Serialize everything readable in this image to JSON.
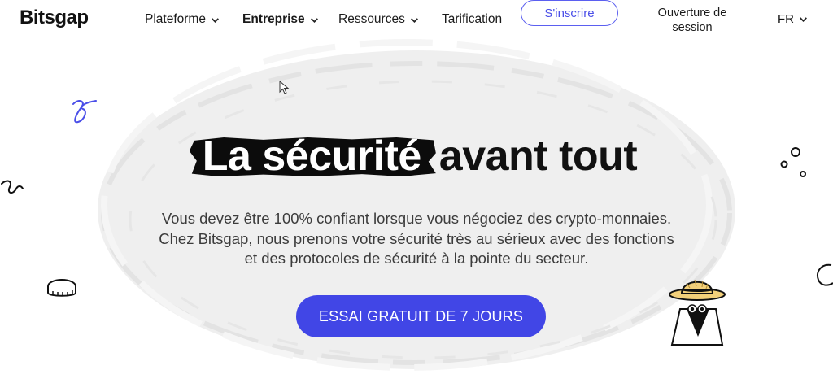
{
  "header": {
    "logo": "Bitsgap",
    "nav": [
      {
        "label": "Plateforme",
        "has_dropdown": true,
        "bold": false
      },
      {
        "label": "Entreprise",
        "has_dropdown": true,
        "bold": true
      },
      {
        "label": "Ressources",
        "has_dropdown": true,
        "bold": false
      },
      {
        "label": "Tarification",
        "has_dropdown": false,
        "bold": false
      }
    ],
    "signup_label": "S'inscrire",
    "login_label": "Ouverture de session",
    "language": "FR"
  },
  "hero": {
    "title_highlight": "La sécurité",
    "title_rest": "avant tout",
    "subtitle": "Vous devez être 100% confiant lorsque vous négociez des crypto-monnaies. Chez Bitsgap, nous prenons votre sécurité très au sérieux avec des fonctions et des protocoles de sécurité à la pointe du secteur.",
    "cta_label": "ESSAI GRATUIT DE 7 JOURS"
  },
  "colors": {
    "accent": "#4146e6",
    "highlight_bg": "#0c0c0c",
    "blob": "#ececec"
  },
  "icons": [
    "chevron-down-icon",
    "coin-icon",
    "squiggle-icon",
    "bubbles-icon",
    "detective-mascot-icon",
    "mouse-cursor-icon"
  ]
}
